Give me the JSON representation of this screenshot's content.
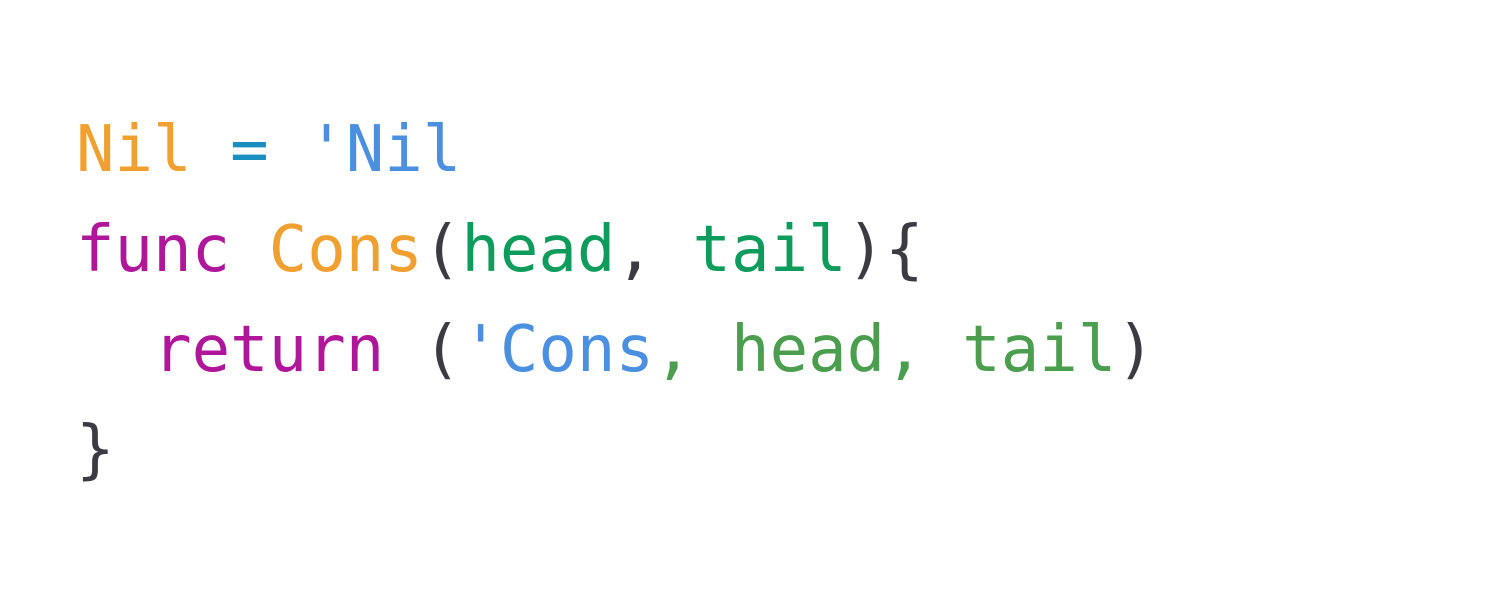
{
  "colors": {
    "background": "#ffffff",
    "type_name": "#f0a030",
    "operator": "#1a8fbf",
    "symbol": "#4a8fe0",
    "keyword": "#b0169a",
    "parameter": "#0e9c5c",
    "argument": "#4a9e4e",
    "punctuation": "#3b3b44"
  },
  "code": {
    "lines": [
      {
        "tokens": [
          {
            "text": "Nil",
            "kind": "type_name"
          },
          {
            "text": " ",
            "kind": "punctuation"
          },
          {
            "text": "=",
            "kind": "operator"
          },
          {
            "text": " ",
            "kind": "punctuation"
          },
          {
            "text": "'Nil",
            "kind": "symbol"
          }
        ]
      },
      {
        "tokens": [
          {
            "text": "func",
            "kind": "keyword"
          },
          {
            "text": " ",
            "kind": "punctuation"
          },
          {
            "text": "Cons",
            "kind": "type_name"
          },
          {
            "text": "(",
            "kind": "punctuation"
          },
          {
            "text": "head",
            "kind": "parameter"
          },
          {
            "text": ", ",
            "kind": "punctuation"
          },
          {
            "text": "tail",
            "kind": "parameter"
          },
          {
            "text": "){",
            "kind": "punctuation"
          }
        ]
      },
      {
        "tokens": [
          {
            "text": "  ",
            "kind": "punctuation"
          },
          {
            "text": "return",
            "kind": "keyword"
          },
          {
            "text": " (",
            "kind": "punctuation"
          },
          {
            "text": "'Cons",
            "kind": "symbol"
          },
          {
            "text": ", head, tail",
            "kind": "argument"
          },
          {
            "text": ")",
            "kind": "punctuation"
          }
        ]
      },
      {
        "tokens": [
          {
            "text": "}",
            "kind": "punctuation"
          }
        ]
      }
    ]
  }
}
